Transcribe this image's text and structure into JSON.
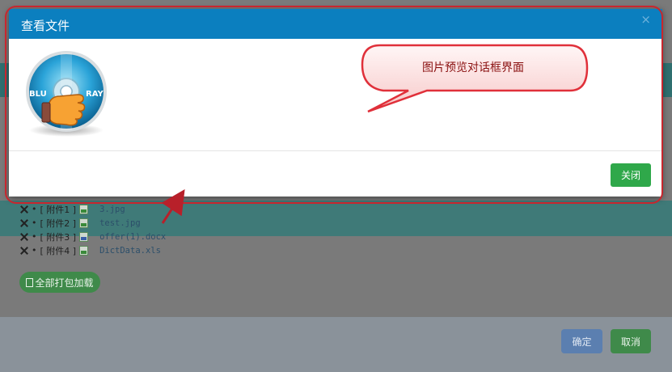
{
  "modal": {
    "title": "查看文件",
    "close_symbol": "×",
    "image_icon": "blu-ray-disc-icon",
    "image_labels": {
      "left": "BLU",
      "right": "RAY"
    },
    "footer_close_label": "关闭"
  },
  "annotation": {
    "callout_text": "图片预览对话框界面",
    "color": "#c8262e"
  },
  "attachments": [
    {
      "label": "[ 附件1 ]",
      "file": "3.jpg",
      "icon": "image-file-icon"
    },
    {
      "label": "[ 附件2 ]",
      "file": "test.jpg",
      "icon": "image-file-icon"
    },
    {
      "label": "[ 附件3 ]",
      "file": "offer(1).docx",
      "icon": "word-file-icon"
    },
    {
      "label": "[ 附件4 ]",
      "file": "DictData.xls",
      "icon": "excel-file-icon"
    }
  ],
  "buttons": {
    "download_all": "全部打包加载",
    "confirm": "确定",
    "cancel": "取消"
  },
  "colors": {
    "header": "#0b7fbf",
    "close_button": "#2fa84a",
    "confirm_button": "#5b7fb0",
    "cancel_button": "#3f8a4a"
  }
}
